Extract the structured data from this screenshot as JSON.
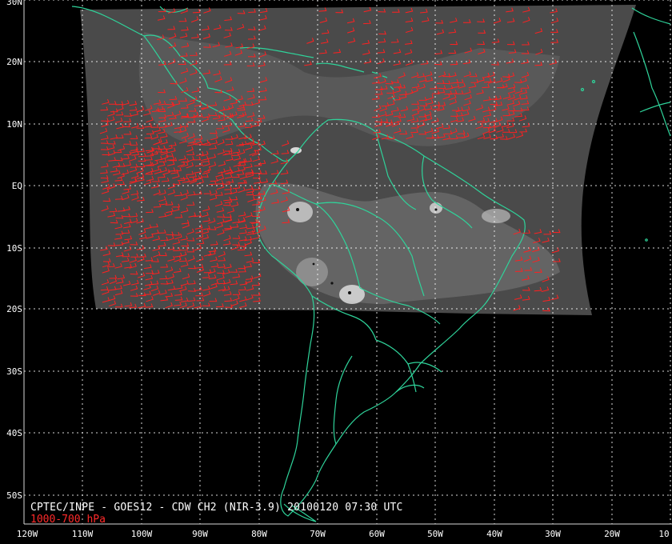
{
  "map": {
    "latitude_labels": [
      "30N",
      "20N",
      "10N",
      "EQ",
      "10S",
      "20S",
      "30S",
      "40S",
      "50S"
    ],
    "longitude_labels": [
      "120W",
      "110W",
      "100W",
      "90W",
      "80W",
      "70W",
      "60W",
      "50W",
      "40W",
      "30W",
      "20W",
      "10"
    ],
    "caption": "CPTEC/INPE - GOES12 - CDW CH2 (NIR-3.9) 20100120 07:30 UTC",
    "level_label": "1000-700 hPa",
    "colors": {
      "background": "#000000",
      "coastline": "#2fd39a",
      "wind_barbs": "#ff2020",
      "grid": "#ffffff",
      "satellite_swath": "#5a5a5a",
      "level_label": "#ff2a2a"
    }
  }
}
